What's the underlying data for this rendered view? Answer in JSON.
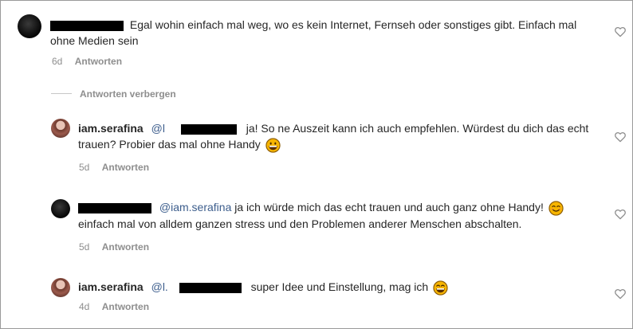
{
  "comments": [
    {
      "text": "Egal wohin einfach mal weg, wo es kein Internet, Fernseh oder sonstiges gibt. Einfach mal",
      "text2": "ohne Medien sein",
      "time": "6d",
      "reply_label": "Antworten"
    }
  ],
  "hide_replies_label": "Antworten verbergen",
  "replies": [
    {
      "username": "iam.serafina",
      "mention": "@l",
      "text": "ja! So ne Auszeit kann ich auch empfehlen. Würdest du dich das echt",
      "text2": "trauen? Probier das mal ohne Handy",
      "time": "5d",
      "reply_label": "Antworten"
    },
    {
      "mention": "@iam.serafina",
      "text": "ja ich würde mich das echt trauen und auch ganz ohne Handy!",
      "text2": "einfach mal von alldem ganzen stress und den Problemen anderer Menschen abschalten.",
      "time": "5d",
      "reply_label": "Antworten"
    },
    {
      "username": "iam.serafina",
      "mention": "@l.",
      "text": "super Idee und Einstellung, mag ich",
      "time": "4d",
      "reply_label": "Antworten"
    }
  ],
  "icons": {
    "like": "heart-icon",
    "emoji_grin": "grinning-face-icon",
    "emoji_smile": "smiling-face-icon"
  },
  "colors": {
    "mention": "#3c5d8c",
    "meta": "#8e8e8e",
    "emoji": "#f7b500"
  }
}
